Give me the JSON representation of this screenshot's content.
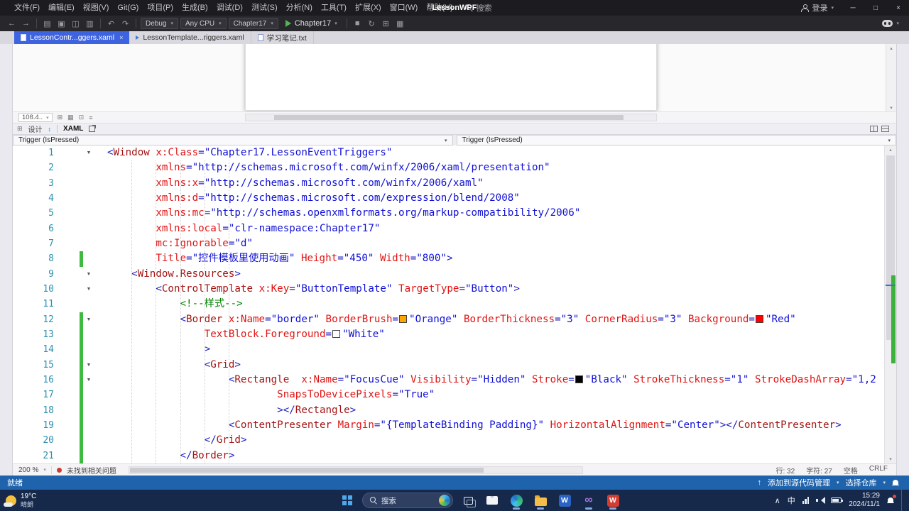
{
  "title_bar": {
    "menu_items": [
      "文件(F)",
      "编辑(E)",
      "视图(V)",
      "Git(G)",
      "项目(P)",
      "生成(B)",
      "调试(D)",
      "测试(S)",
      "分析(N)",
      "工具(T)",
      "扩展(X)",
      "窗口(W)",
      "帮助(H)"
    ],
    "search_label": "搜索",
    "app_title": "LessonWPF",
    "sign_in": "登录"
  },
  "toolbar": {
    "config": "Debug",
    "platform": "Any CPU",
    "startup_project": "Chapter17",
    "run_label": "Chapter17"
  },
  "tabs": [
    {
      "label": "LessonContr...ggers.xaml",
      "active": true,
      "icon": "doc"
    },
    {
      "label": "LessonTemplate...riggers.xaml",
      "active": false,
      "icon": "arrow"
    },
    {
      "label": "学习笔记.txt",
      "active": false,
      "icon": "doc"
    }
  ],
  "designer": {
    "zoom": "108.4..",
    "design_tab": "设计",
    "xaml_tab": "XAML"
  },
  "nav_bars": {
    "left": "Trigger (IsPressed)",
    "right": "Trigger (IsPressed)"
  },
  "editor": {
    "fold_lines": [
      1,
      9,
      10,
      12,
      15,
      16
    ],
    "changed_lines": [
      8,
      12,
      13,
      14,
      15,
      16,
      17,
      18,
      19,
      20,
      21
    ],
    "lines": [
      [
        [
          "pu",
          "<"
        ],
        [
          "el",
          "Window"
        ],
        [
          "tx",
          " "
        ],
        [
          "at",
          "x:Class"
        ],
        [
          "pu",
          "="
        ],
        [
          "va",
          "\"Chapter17.LessonEventTriggers\""
        ]
      ],
      [
        [
          "tx",
          "        "
        ],
        [
          "at",
          "xmlns"
        ],
        [
          "pu",
          "="
        ],
        [
          "va",
          "\"http://schemas.microsoft.com/winfx/2006/xaml/presentation\""
        ]
      ],
      [
        [
          "tx",
          "        "
        ],
        [
          "at",
          "xmlns:x"
        ],
        [
          "pu",
          "="
        ],
        [
          "va",
          "\"http://schemas.microsoft.com/winfx/2006/xaml\""
        ]
      ],
      [
        [
          "tx",
          "        "
        ],
        [
          "at",
          "xmlns:d"
        ],
        [
          "pu",
          "="
        ],
        [
          "va",
          "\"http://schemas.microsoft.com/expression/blend/2008\""
        ]
      ],
      [
        [
          "tx",
          "        "
        ],
        [
          "at",
          "xmlns:mc"
        ],
        [
          "pu",
          "="
        ],
        [
          "va",
          "\"http://schemas.openxmlformats.org/markup-compatibility/2006\""
        ]
      ],
      [
        [
          "tx",
          "        "
        ],
        [
          "at",
          "xmlns:local"
        ],
        [
          "pu",
          "="
        ],
        [
          "va",
          "\"clr-namespace:Chapter17\""
        ]
      ],
      [
        [
          "tx",
          "        "
        ],
        [
          "at",
          "mc:Ignorable"
        ],
        [
          "pu",
          "="
        ],
        [
          "va",
          "\"d\""
        ]
      ],
      [
        [
          "tx",
          "        "
        ],
        [
          "at",
          "Title"
        ],
        [
          "pu",
          "="
        ],
        [
          "va",
          "\"控件模板里使用动画\""
        ],
        [
          "tx",
          " "
        ],
        [
          "at",
          "Height"
        ],
        [
          "pu",
          "="
        ],
        [
          "va",
          "\"450\""
        ],
        [
          "tx",
          " "
        ],
        [
          "at",
          "Width"
        ],
        [
          "pu",
          "="
        ],
        [
          "va",
          "\"800\""
        ],
        [
          "pu",
          ">"
        ]
      ],
      [
        [
          "tx",
          "    "
        ],
        [
          "pu",
          "<"
        ],
        [
          "el",
          "Window.Resources"
        ],
        [
          "pu",
          ">"
        ]
      ],
      [
        [
          "tx",
          "        "
        ],
        [
          "pu",
          "<"
        ],
        [
          "el",
          "ControlTemplate"
        ],
        [
          "tx",
          " "
        ],
        [
          "at",
          "x:Key"
        ],
        [
          "pu",
          "="
        ],
        [
          "va",
          "\"ButtonTemplate\""
        ],
        [
          "tx",
          " "
        ],
        [
          "at",
          "TargetType"
        ],
        [
          "pu",
          "="
        ],
        [
          "va",
          "\"Button\""
        ],
        [
          "pu",
          ">"
        ]
      ],
      [
        [
          "tx",
          "            "
        ],
        [
          "cm",
          "<!--样式-->"
        ]
      ],
      [
        [
          "tx",
          "            "
        ],
        [
          "pu",
          "<"
        ],
        [
          "el",
          "Border"
        ],
        [
          "tx",
          " "
        ],
        [
          "at",
          "x:Name"
        ],
        [
          "pu",
          "="
        ],
        [
          "va",
          "\"border\""
        ],
        [
          "tx",
          " "
        ],
        [
          "at",
          "BorderBrush"
        ],
        [
          "pu",
          "="
        ],
        [
          "sw",
          "#FFA500"
        ],
        [
          "va",
          "\"Orange\""
        ],
        [
          "tx",
          " "
        ],
        [
          "at",
          "BorderThickness"
        ],
        [
          "pu",
          "="
        ],
        [
          "va",
          "\"3\""
        ],
        [
          "tx",
          " "
        ],
        [
          "at",
          "CornerRadius"
        ],
        [
          "pu",
          "="
        ],
        [
          "va",
          "\"3\""
        ],
        [
          "tx",
          " "
        ],
        [
          "at",
          "Background"
        ],
        [
          "pu",
          "="
        ],
        [
          "sw",
          "#FF0000"
        ],
        [
          "va",
          "\"Red\""
        ]
      ],
      [
        [
          "tx",
          "                "
        ],
        [
          "at",
          "TextBlock.Foreground"
        ],
        [
          "pu",
          "="
        ],
        [
          "sw",
          "#FFFFFF"
        ],
        [
          "va",
          "\"White\""
        ]
      ],
      [
        [
          "tx",
          "                "
        ],
        [
          "pu",
          ">"
        ]
      ],
      [
        [
          "tx",
          "                "
        ],
        [
          "pu",
          "<"
        ],
        [
          "el",
          "Grid"
        ],
        [
          "pu",
          ">"
        ]
      ],
      [
        [
          "tx",
          "                    "
        ],
        [
          "pu",
          "<"
        ],
        [
          "el",
          "Rectangle"
        ],
        [
          "tx",
          "  "
        ],
        [
          "at",
          "x:Name"
        ],
        [
          "pu",
          "="
        ],
        [
          "va",
          "\"FocusCue\""
        ],
        [
          "tx",
          " "
        ],
        [
          "at",
          "Visibility"
        ],
        [
          "pu",
          "="
        ],
        [
          "va",
          "\"Hidden\""
        ],
        [
          "tx",
          " "
        ],
        [
          "at",
          "Stroke"
        ],
        [
          "pu",
          "="
        ],
        [
          "sw",
          "#000000"
        ],
        [
          "va",
          "\"Black\""
        ],
        [
          "tx",
          " "
        ],
        [
          "at",
          "StrokeThickness"
        ],
        [
          "pu",
          "="
        ],
        [
          "va",
          "\"1\""
        ],
        [
          "tx",
          " "
        ],
        [
          "at",
          "StrokeDashArray"
        ],
        [
          "pu",
          "="
        ],
        [
          "va",
          "\"1,2"
        ]
      ],
      [
        [
          "tx",
          "                            "
        ],
        [
          "at",
          "SnapsToDevicePixels"
        ],
        [
          "pu",
          "="
        ],
        [
          "va",
          "\"True\""
        ]
      ],
      [
        [
          "tx",
          "                            "
        ],
        [
          "pu",
          "></"
        ],
        [
          "el",
          "Rectangle"
        ],
        [
          "pu",
          ">"
        ]
      ],
      [
        [
          "tx",
          "                    "
        ],
        [
          "pu",
          "<"
        ],
        [
          "el",
          "ContentPresenter"
        ],
        [
          "tx",
          " "
        ],
        [
          "at",
          "Margin"
        ],
        [
          "pu",
          "="
        ],
        [
          "va",
          "\"{TemplateBinding Padding}\""
        ],
        [
          "tx",
          " "
        ],
        [
          "at",
          "HorizontalAlignment"
        ],
        [
          "pu",
          "="
        ],
        [
          "va",
          "\"Center\""
        ],
        [
          "pu",
          "></"
        ],
        [
          "el",
          "ContentPresenter"
        ],
        [
          "pu",
          ">"
        ]
      ],
      [
        [
          "tx",
          "                "
        ],
        [
          "pu",
          "</"
        ],
        [
          "el",
          "Grid"
        ],
        [
          "pu",
          ">"
        ]
      ],
      [
        [
          "tx",
          "            "
        ],
        [
          "pu",
          "</"
        ],
        [
          "el",
          "Border"
        ],
        [
          "pu",
          ">"
        ]
      ]
    ]
  },
  "editor_status": {
    "zoom": "200 %",
    "issues": "未找到相关问题",
    "line": "行: 32",
    "column": "字符: 27",
    "spaces": "空格",
    "line_ending": "CRLF"
  },
  "status_bar": {
    "ready": "就绪",
    "add_to_source_control": "添加到源代码管理",
    "select_repo": "选择仓库"
  },
  "taskbar": {
    "weather_temp": "19°C",
    "weather_desc": "晴朗",
    "search_placeholder": "搜索",
    "ime": "中",
    "time": "15:29",
    "date": "2024/11/1"
  },
  "icons": {
    "chevron_down": "▾",
    "back": "←",
    "forward": "→",
    "new_file": "▤",
    "open_file": "▣",
    "save": "◫",
    "save_all": "▥",
    "undo": "↶",
    "redo": "↷",
    "refresh": "↻",
    "stop": "■",
    "fold_open": "▼",
    "up_arrow": "↑",
    "tray_chevron": "∧",
    "vs_logo": "∞",
    "word_letter": "W",
    "wps_letter": "W",
    "designer_fit": "⊞",
    "designer_grid": "▦",
    "designer_snap": "⊡",
    "designer_guides": "≡",
    "swap": "↕",
    "scroll_up": "▴",
    "scroll_down": "▾",
    "scroll_left": "◂",
    "scroll_right": "▸",
    "minimize": "─",
    "maximize": "□",
    "close": "×"
  }
}
